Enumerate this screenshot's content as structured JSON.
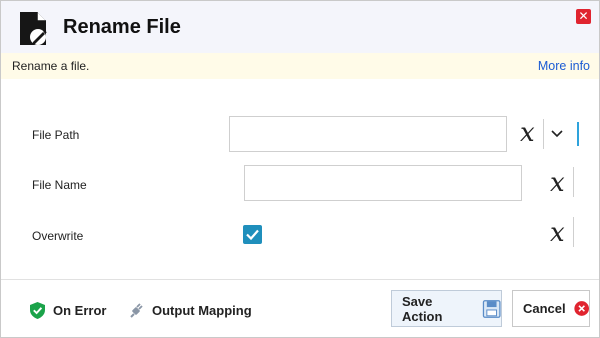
{
  "dialog": {
    "title": "Rename File",
    "icon": "file-edit-icon",
    "close_icon": "close-icon"
  },
  "info": {
    "description": "Rename a file.",
    "more_info_label": "More info"
  },
  "form": {
    "file_path": {
      "label": "File Path",
      "value": "",
      "variable_symbol": "x"
    },
    "file_name": {
      "label": "File Name",
      "value": "",
      "variable_symbol": "x"
    },
    "overwrite": {
      "label": "Overwrite",
      "checked": true,
      "variable_symbol": "x"
    }
  },
  "footer": {
    "on_error_label": "On Error",
    "output_mapping_label": "Output Mapping",
    "save_label": "Save Action",
    "cancel_label": "Cancel"
  },
  "colors": {
    "accent": "#1f8fbc",
    "link": "#1b5bd3",
    "close": "#e0242f",
    "shield": "#1ba34a",
    "cancel": "#e0242f"
  }
}
